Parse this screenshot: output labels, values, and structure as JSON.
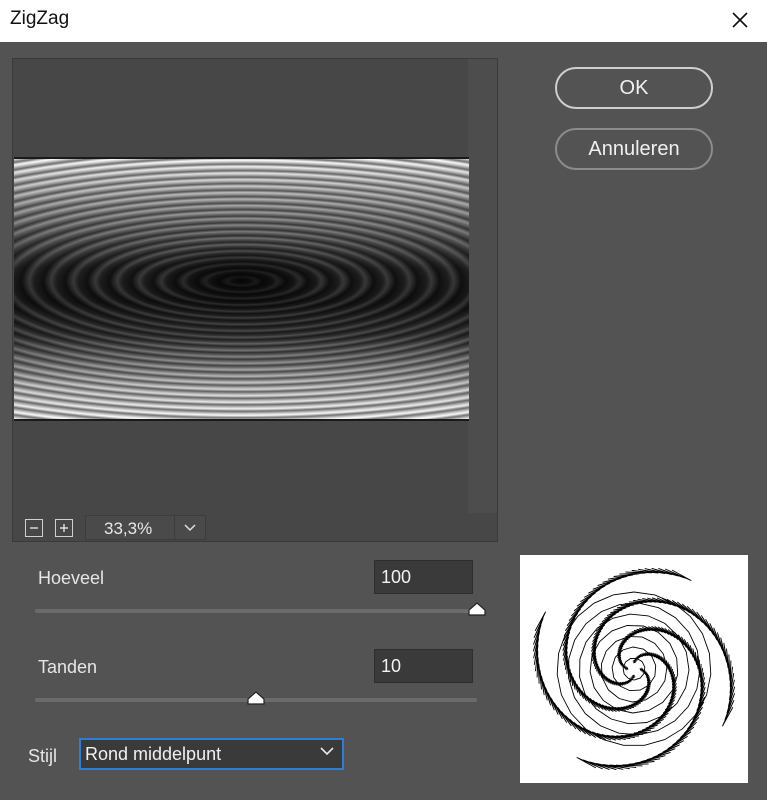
{
  "window": {
    "title": "ZigZag",
    "close_icon": "close-icon"
  },
  "preview": {
    "zoom_out_icon": "minus-icon",
    "zoom_in_icon": "plus-icon",
    "zoom_level": "33,3%",
    "zoom_dropdown_icon": "chevron-down-icon"
  },
  "buttons": {
    "ok": "OK",
    "cancel": "Annuleren"
  },
  "controls": {
    "amount": {
      "label": "Hoeveel",
      "value": "100",
      "slider_fraction": 1.0
    },
    "ridges": {
      "label": "Tanden",
      "value": "10",
      "slider_fraction": 0.5
    },
    "style": {
      "label": "Stijl",
      "value": "Rond middelpunt",
      "chevron_icon": "chevron-down-icon"
    }
  },
  "colors": {
    "dialog_bg": "#535353",
    "accent_focus": "#2d7fd6",
    "field_bg": "#3a3a3a"
  }
}
